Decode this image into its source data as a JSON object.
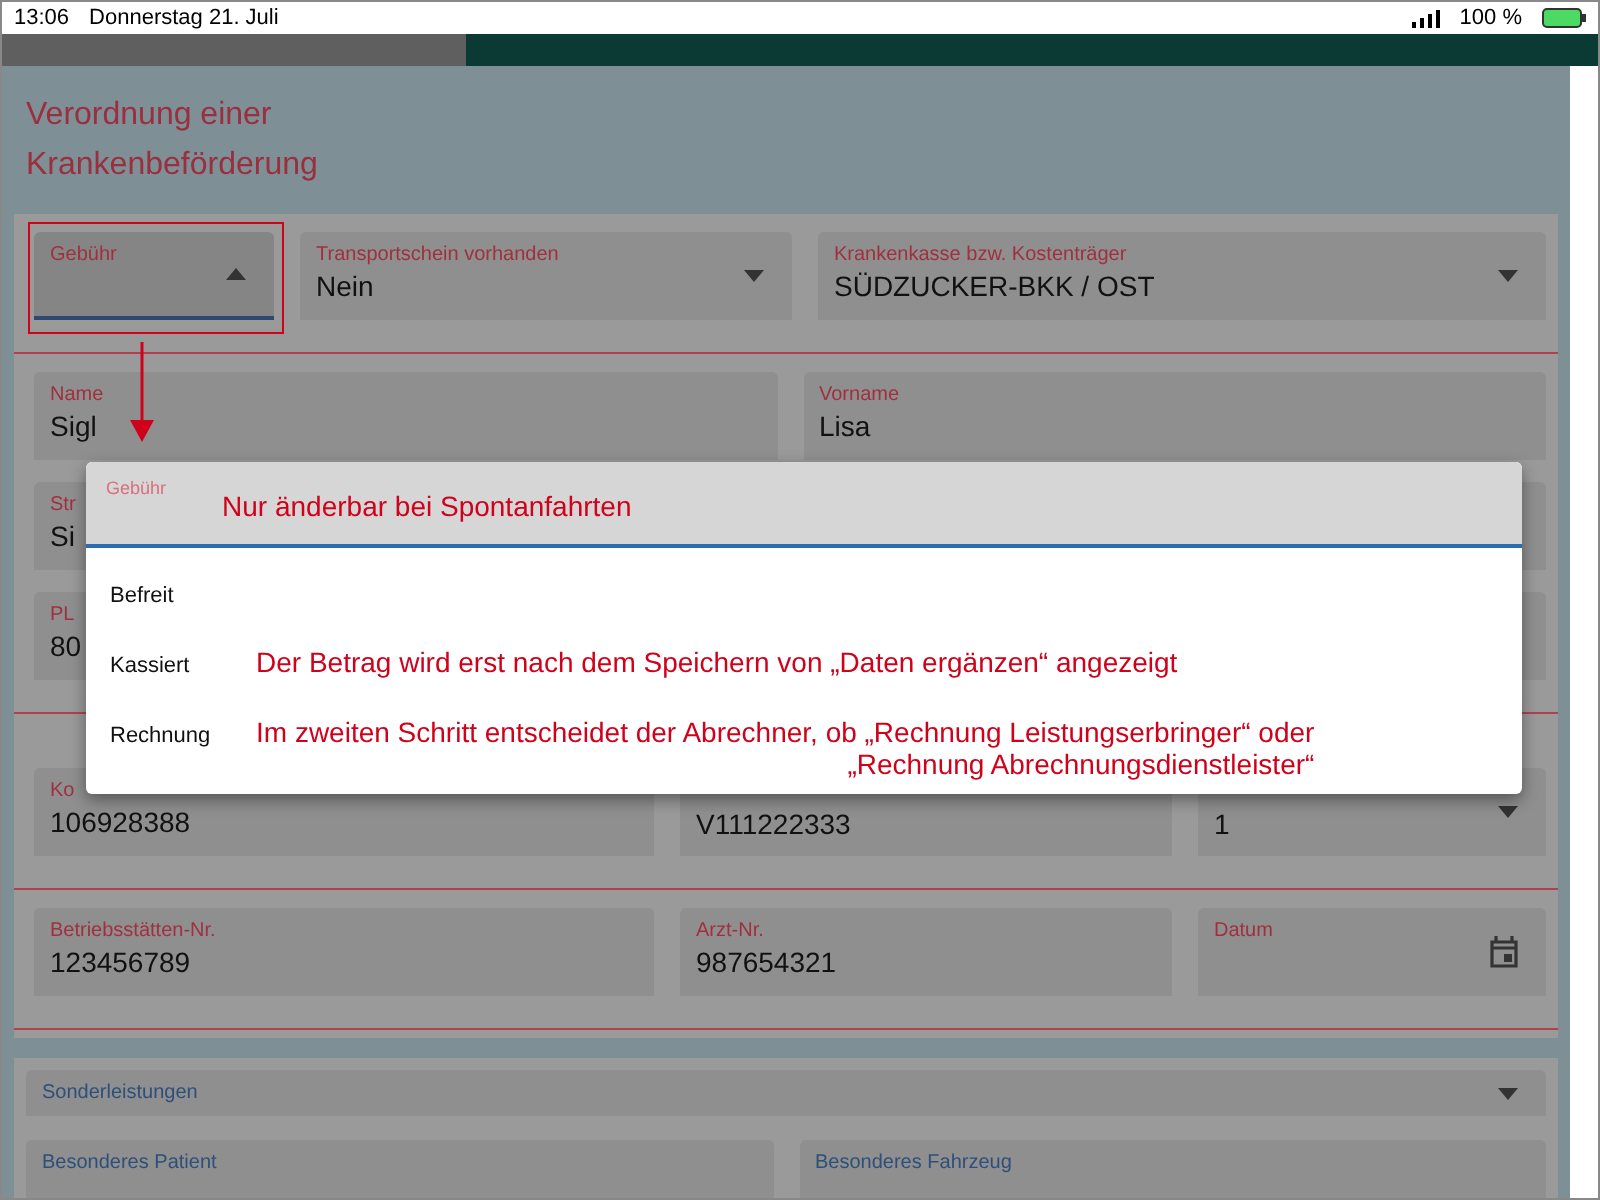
{
  "status_bar": {
    "time": "13:06",
    "date": "Donnerstag 21. Juli",
    "battery": "100 %"
  },
  "title": [
    "Verordnung einer",
    "Krankenbeförderung"
  ],
  "form_rows": [
    {
      "fields": [
        {
          "kind": "select",
          "label": "Gebühr",
          "expanded": true,
          "highlighted": true
        },
        {
          "kind": "select",
          "label": "Transportschein vorhanden",
          "value": "Nein",
          "expanded": false
        },
        {
          "kind": "select",
          "label": "Krankenkasse bzw. Kostenträger",
          "value": "SÜDZUCKER-BKK / OST",
          "expanded": false
        }
      ],
      "divider": true
    },
    {
      "fields": [
        {
          "kind": "text",
          "label": "Name",
          "value": "Sigl"
        },
        {
          "kind": "text",
          "label": "Vorname",
          "value": "Lisa"
        }
      ],
      "divider": false
    },
    {
      "fields": [
        {
          "kind": "text",
          "label": "Str",
          "value": "Si"
        },
        {
          "kind": "date"
        }
      ],
      "divider": false
    },
    {
      "fields": [
        {
          "kind": "text",
          "label": "PL",
          "value": "80"
        },
        {
          "kind": "text"
        }
      ],
      "divider": true
    },
    {
      "fields": [
        {
          "kind": "text",
          "label": "Ko",
          "value": "106928388"
        },
        {
          "kind": "text",
          "value": "V111222333"
        },
        {
          "kind": "select",
          "value": "1",
          "expanded": false
        }
      ],
      "divider": true
    },
    {
      "fields": [
        {
          "kind": "text",
          "label": "Betriebsstätten-Nr.",
          "value": "123456789"
        },
        {
          "kind": "text",
          "label": "Arzt-Nr.",
          "value": "987654321"
        },
        {
          "kind": "date",
          "label": "Datum"
        }
      ],
      "divider": true
    }
  ],
  "section_2": {
    "select": {
      "label": "Sonderleistungen",
      "expanded": false
    },
    "fields": [
      {
        "label": "Besonderes Patient"
      },
      {
        "label": "Besonderes Fahrzeug"
      }
    ]
  },
  "dialog": {
    "label": "Gebühr",
    "hint": "Nur änderbar bei Spontanfahrten",
    "options": [
      {
        "label": "Befreit",
        "selected": false
      },
      {
        "label": "Kassiert",
        "selected": false,
        "note": "Der Betrag wird erst nach dem Speichern von „Daten ergänzen“ angezeigt"
      },
      {
        "label": "Rechnung",
        "selected": false,
        "note": "Im zweiten Schritt entscheidet der Abrechner, ob „Rechnung Leistungserbringer“ oder",
        "note_2": "„Rechnung Abrechnungsdienstleister“"
      }
    ]
  }
}
